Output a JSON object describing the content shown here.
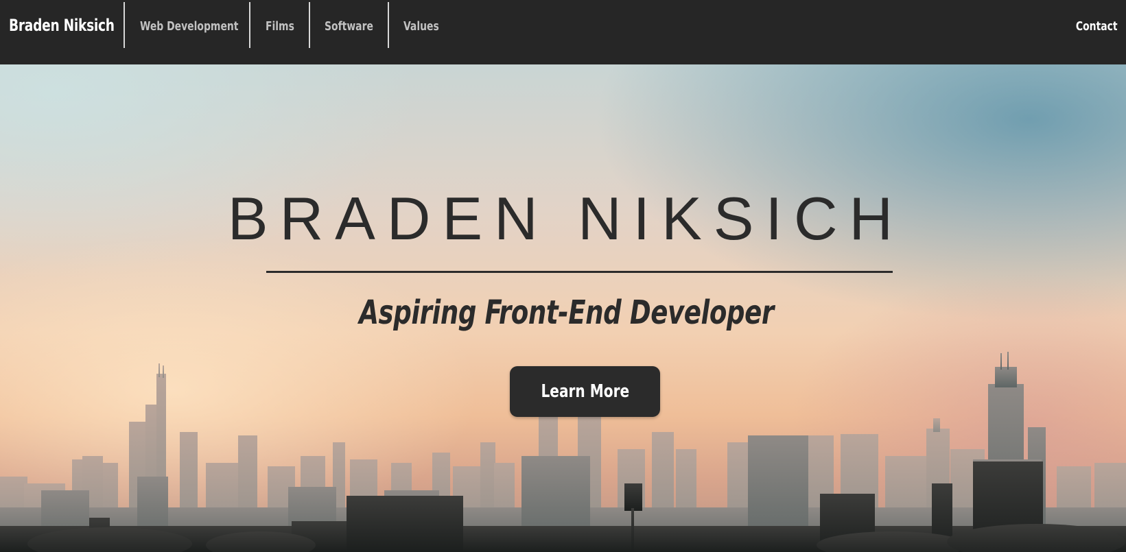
{
  "nav": {
    "brand": "Braden Niksich",
    "links": [
      {
        "label": "Web Development"
      },
      {
        "label": "Films"
      },
      {
        "label": "Software"
      },
      {
        "label": "Values"
      }
    ],
    "contact": "Contact"
  },
  "hero": {
    "title": "BRADEN NIKSICH",
    "subtitle": "Aspiring Front-End Developer",
    "button_label": "Learn More"
  },
  "colors": {
    "nav_background": "#262626",
    "text_dark": "#2b2b2b",
    "button_background": "#2b2b2b"
  }
}
